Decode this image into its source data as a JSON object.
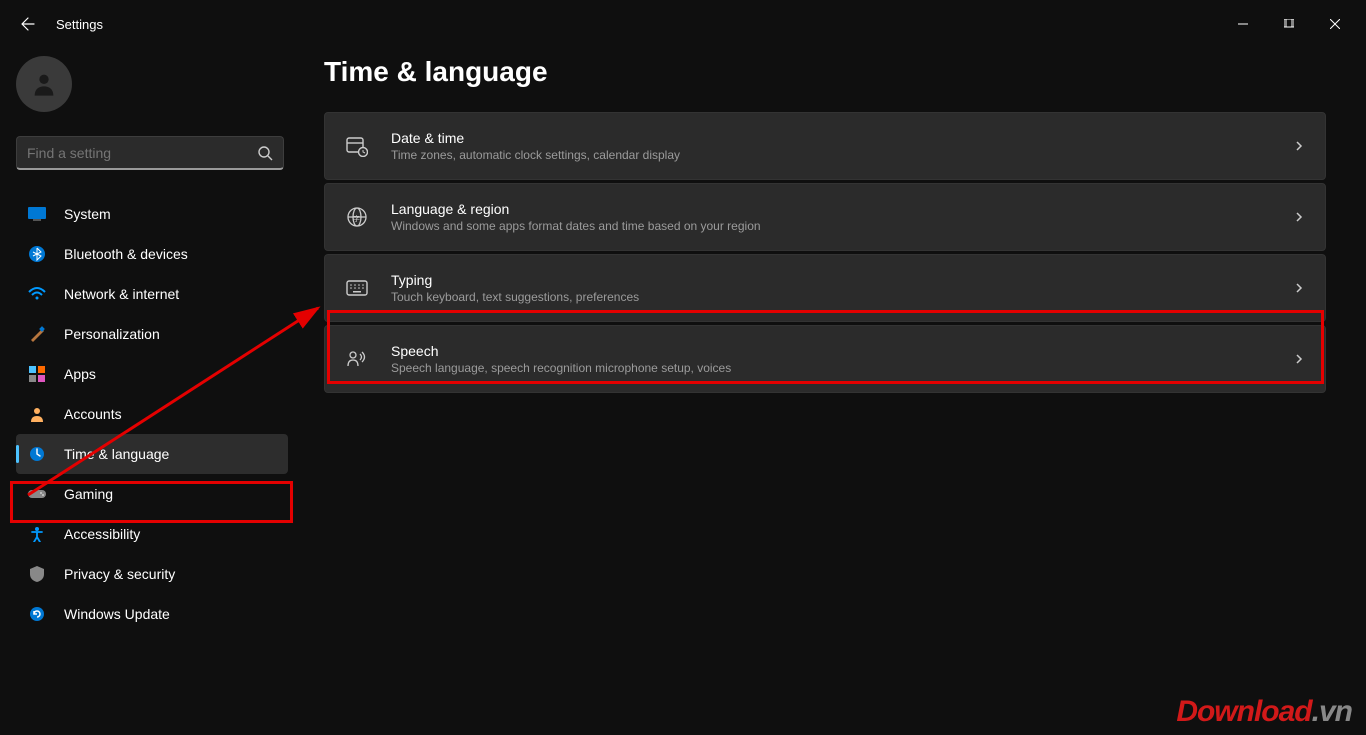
{
  "window": {
    "title": "Settings"
  },
  "search": {
    "placeholder": "Find a setting"
  },
  "sidebar": {
    "items": [
      {
        "label": "System"
      },
      {
        "label": "Bluetooth & devices"
      },
      {
        "label": "Network & internet"
      },
      {
        "label": "Personalization"
      },
      {
        "label": "Apps"
      },
      {
        "label": "Accounts"
      },
      {
        "label": "Time & language"
      },
      {
        "label": "Gaming"
      },
      {
        "label": "Accessibility"
      },
      {
        "label": "Privacy & security"
      },
      {
        "label": "Windows Update"
      }
    ]
  },
  "main": {
    "title": "Time & language",
    "items": [
      {
        "title": "Date & time",
        "desc": "Time zones, automatic clock settings, calendar display"
      },
      {
        "title": "Language & region",
        "desc": "Windows and some apps format dates and time based on your region"
      },
      {
        "title": "Typing",
        "desc": "Touch keyboard, text suggestions, preferences"
      },
      {
        "title": "Speech",
        "desc": "Speech language, speech recognition microphone setup, voices"
      }
    ]
  },
  "watermark": {
    "text": "Download",
    "suffix": ".vn"
  }
}
